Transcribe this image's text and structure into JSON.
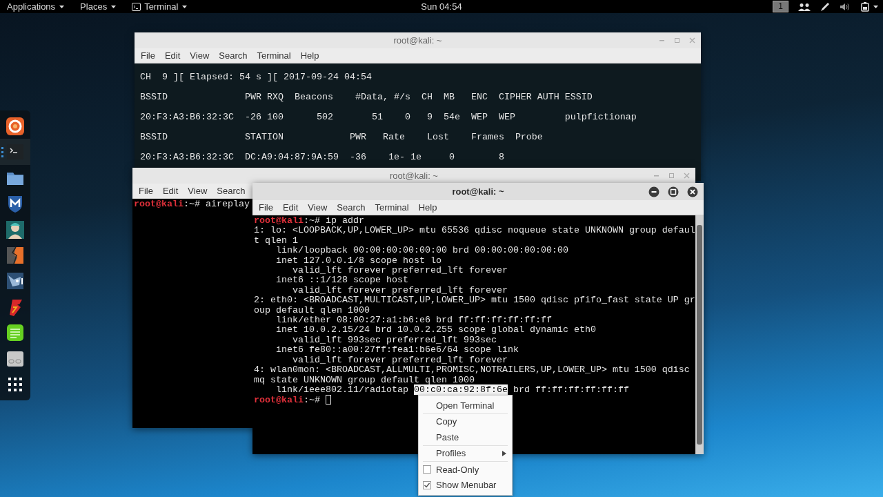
{
  "top_bar": {
    "menus": [
      {
        "label": "Applications",
        "kind": "plain"
      },
      {
        "label": "Places",
        "kind": "plain"
      },
      {
        "label": "Terminal",
        "kind": "terminal"
      }
    ],
    "clock": "Sun 04:54",
    "workspace": "1"
  },
  "dock": {
    "items": [
      {
        "selected": false
      },
      {
        "selected": true
      },
      {
        "selected": false
      },
      {
        "selected": false
      },
      {
        "selected": false
      },
      {
        "selected": false
      },
      {
        "selected": false
      },
      {
        "selected": false
      },
      {
        "selected": false
      },
      {
        "selected": false
      },
      {
        "selected": false
      }
    ]
  },
  "windows": [
    {
      "title": "root@kali: ~",
      "active": false,
      "kind": "airodump",
      "menu": [
        "File",
        "Edit",
        "View",
        "Search",
        "Terminal",
        "Help"
      ],
      "lines": [
        "CH  9 ][ Elapsed: 54 s ][ 2017-09-24 04:54",
        "BSSID              PWR RXQ  Beacons    #Data, #/s  CH  MB   ENC  CIPHER AUTH ESSID",
        "20:F3:A3:B6:32:3C  -26 100      502       51    0   9  54e  WEP  WEP         pulpfictionap",
        "BSSID              STATION            PWR   Rate    Lost    Frames  Probe",
        "20:F3:A3:B6:32:3C  DC:A9:04:87:9A:59  -36    1e- 1e     0        8"
      ]
    },
    {
      "title": "root@kali: ~",
      "active": false,
      "kind": "shell",
      "menu": [
        "File",
        "Edit",
        "View",
        "Search"
      ],
      "lines": [
        {
          "prompt": "root@kali",
          "text": ":~# aireplay"
        }
      ]
    },
    {
      "title": "root@kali: ~",
      "active": true,
      "kind": "shell",
      "menu": [
        "File",
        "Edit",
        "View",
        "Search",
        "Terminal",
        "Help"
      ],
      "lines": [
        {
          "prompt": "root@kali",
          "text": ":~# ip addr"
        },
        "1: lo: <LOOPBACK,UP,LOWER_UP> mtu 65536 qdisc noqueue state UNKNOWN group defaul",
        "t qlen 1",
        "    link/loopback 00:00:00:00:00:00 brd 00:00:00:00:00:00",
        "    inet 127.0.0.1/8 scope host lo",
        "       valid_lft forever preferred_lft forever",
        "    inet6 ::1/128 scope host",
        "       valid_lft forever preferred_lft forever",
        "2: eth0: <BROADCAST,MULTICAST,UP,LOWER_UP> mtu 1500 qdisc pfifo_fast state UP gr",
        "oup default qlen 1000",
        "    link/ether 08:00:27:a1:b6:e6 brd ff:ff:ff:ff:ff:ff",
        "    inet 10.0.2.15/24 brd 10.0.2.255 scope global dynamic eth0",
        "       valid_lft 993sec preferred_lft 993sec",
        "    inet6 fe80::a00:27ff:fea1:b6e6/64 scope link",
        "       valid_lft forever preferred_lft forever",
        "4: wlan0mon: <BROADCAST,ALLMULTI,PROMISC,NOTRAILERS,UP,LOWER_UP> mtu 1500 qdisc",
        "mq state UNKNOWN group default qlen 1000",
        {
          "text": "    link/ieee802.11/radiotap ",
          "selection": "00:c0:ca:92:8f:6e",
          "rest": " brd ff:ff:ff:ff:ff:ff"
        },
        {
          "prompt": "root@kali",
          "text": ":~# ",
          "cursor": true
        }
      ]
    }
  ],
  "context_menu": {
    "sections": [
      [
        {
          "kind": "item",
          "label": "Open Terminal"
        }
      ],
      [
        {
          "kind": "item",
          "label": "Copy"
        },
        {
          "kind": "item",
          "label": "Paste"
        }
      ],
      [
        {
          "kind": "submenu",
          "label": "Profiles"
        }
      ],
      [
        {
          "kind": "check",
          "label": "Read-Only",
          "checked": false
        },
        {
          "kind": "check",
          "label": "Show Menubar",
          "checked": true
        }
      ]
    ]
  }
}
